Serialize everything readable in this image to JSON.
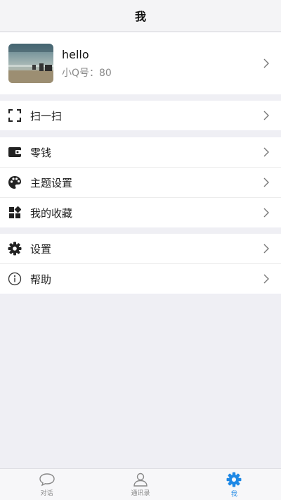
{
  "navbar": {
    "title": "我"
  },
  "profile": {
    "name": "hello",
    "id_text": "小Q号：80"
  },
  "groups": [
    {
      "items": [
        {
          "label": "扫一扫",
          "icon": "scan-icon"
        }
      ]
    },
    {
      "items": [
        {
          "label": "零钱",
          "icon": "wallet-icon"
        },
        {
          "label": "主题设置",
          "icon": "palette-icon"
        },
        {
          "label": "我的收藏",
          "icon": "favorites-icon"
        }
      ]
    },
    {
      "items": [
        {
          "label": "设置",
          "icon": "gear-icon"
        },
        {
          "label": "帮助",
          "icon": "info-icon"
        }
      ]
    }
  ],
  "tabbar": {
    "tabs": [
      {
        "label": "对话",
        "icon": "chat-bubble-icon"
      },
      {
        "label": "通讯录",
        "icon": "contact-icon"
      },
      {
        "label": "我",
        "icon": "gear-icon",
        "active": true
      }
    ]
  },
  "colors": {
    "accent": "#1e88e5",
    "background": "#efeff4"
  }
}
